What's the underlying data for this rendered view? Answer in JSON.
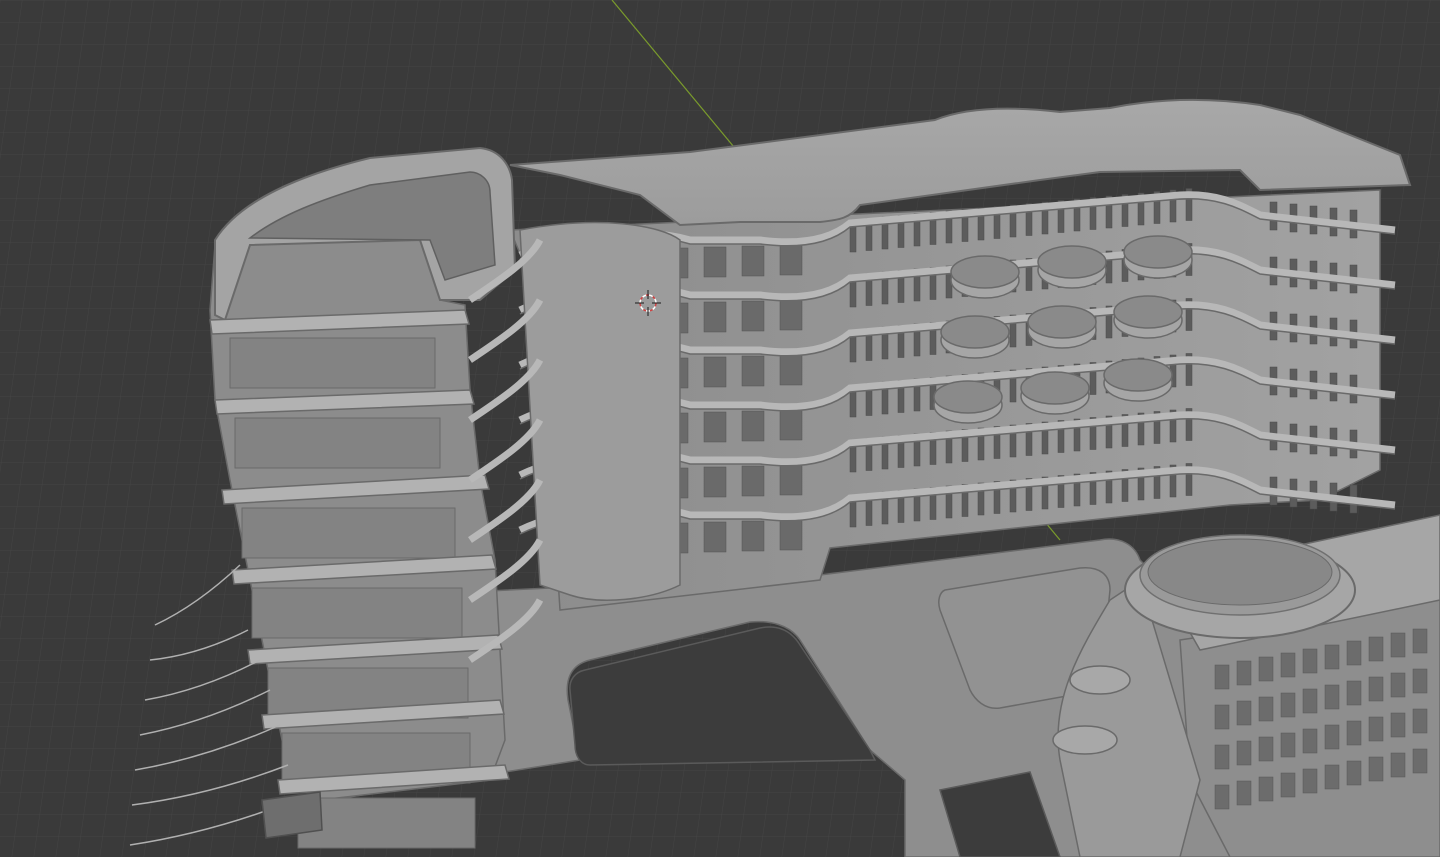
{
  "app": {
    "name": "",
    "view": "3D Viewport"
  },
  "viewport": {
    "background_color": "#3a3a3a",
    "grid_color": "#444444",
    "grid_major_color": "#4a4a4a",
    "axis_y_color": "#7a9b2c",
    "model_fill": "#9a9a9a",
    "model_light": "#b4b4b4",
    "model_dark": "#6e6e6e",
    "model_edge": "#5a5a5a",
    "cursor_color": "#d04040"
  },
  "scene": {
    "object": "building-model",
    "cursor": "3d-cursor"
  }
}
